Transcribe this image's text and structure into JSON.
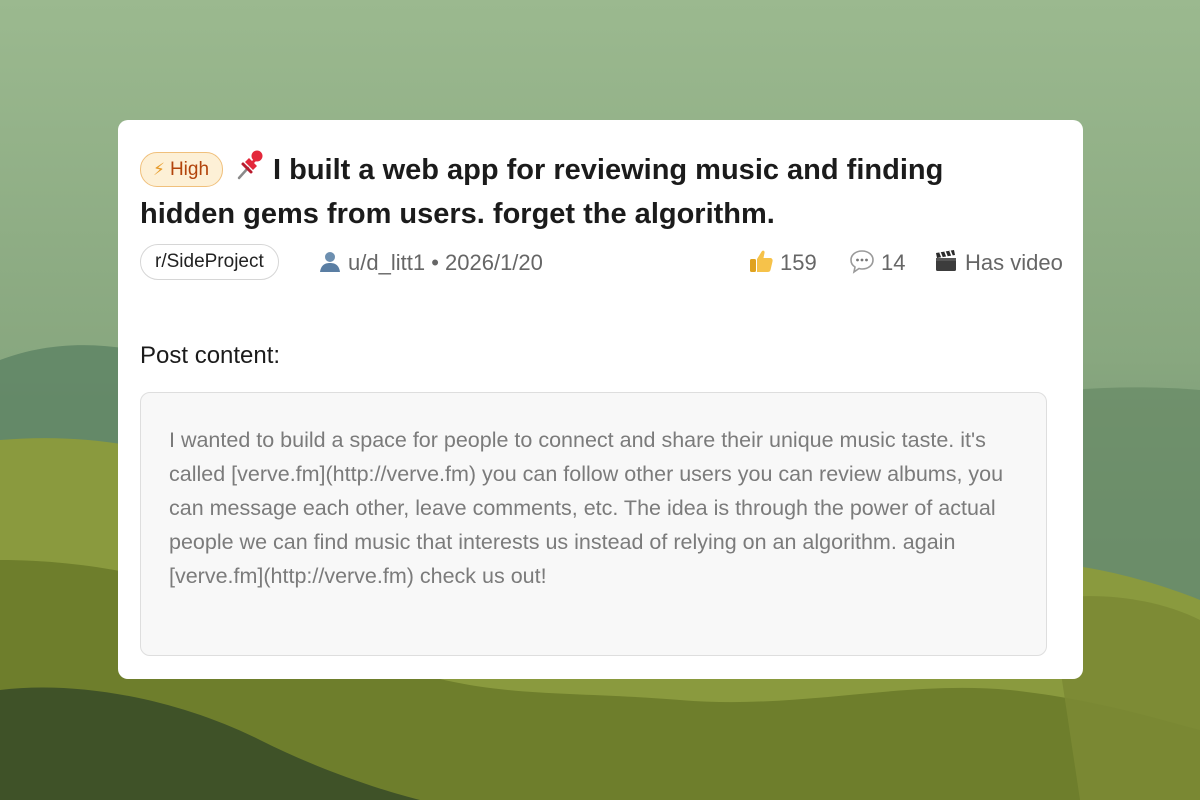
{
  "post": {
    "priority_badge": {
      "icon": "lightning-icon",
      "label": "High"
    },
    "pin_icon": "pushpin-icon",
    "title": "I built a web app for reviewing music and finding hidden gems from users. forget the algorithm.",
    "subreddit": "r/SideProject",
    "author": "u/d_litt1",
    "separator": "•",
    "date": "2026/1/20",
    "upvotes": "159",
    "comments": "14",
    "media_label": "Has video",
    "content_label": "Post content:",
    "content": "I wanted to build a space for people to connect and share their unique music taste. it's called [verve.fm](http://verve.fm) you can follow other users you can review albums, you can message each other, leave comments, etc. The idea is through the power of actual people we can find music that interests us instead of relying on an algorithm. again [verve.fm](http://verve.fm) check us out!"
  },
  "colors": {
    "badge_bg": "#fdf0d6",
    "badge_border": "#f0c07c",
    "badge_text": "#b2440c",
    "background_green": "#8aa980"
  }
}
